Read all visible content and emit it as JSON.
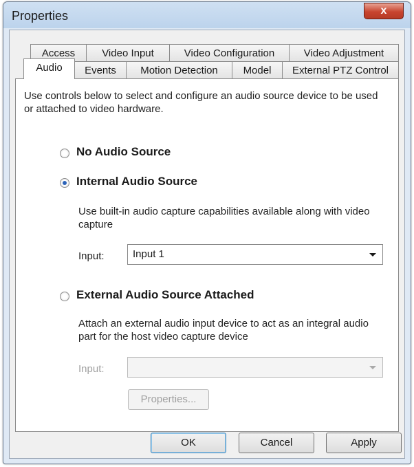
{
  "window": {
    "title": "Properties",
    "close_glyph": "x"
  },
  "tabs_row1": [
    "Access",
    "Video Input",
    "Video Configuration",
    "Video Adjustment"
  ],
  "tabs_row2": [
    "Audio",
    "Events",
    "Motion Detection",
    "Model",
    "External PTZ Control"
  ],
  "active_tab": "Audio",
  "panel": {
    "intro": "Use controls below to select and configure an audio source device to be used or attached to video hardware.",
    "options": {
      "none": {
        "label": "No Audio Source",
        "checked": false
      },
      "internal": {
        "label": "Internal Audio Source",
        "checked": true,
        "description": "Use built-in audio capture capabilities available along with video capture",
        "input_label": "Input:",
        "input_value": "Input 1"
      },
      "external": {
        "label": "External Audio Source Attached",
        "checked": false,
        "description": "Attach an external audio input device to act as an integral audio part for the host video capture device",
        "input_label": "Input:",
        "input_value": "",
        "properties_label": "Properties..."
      }
    }
  },
  "footer": {
    "ok": "OK",
    "cancel": "Cancel",
    "apply": "Apply"
  }
}
